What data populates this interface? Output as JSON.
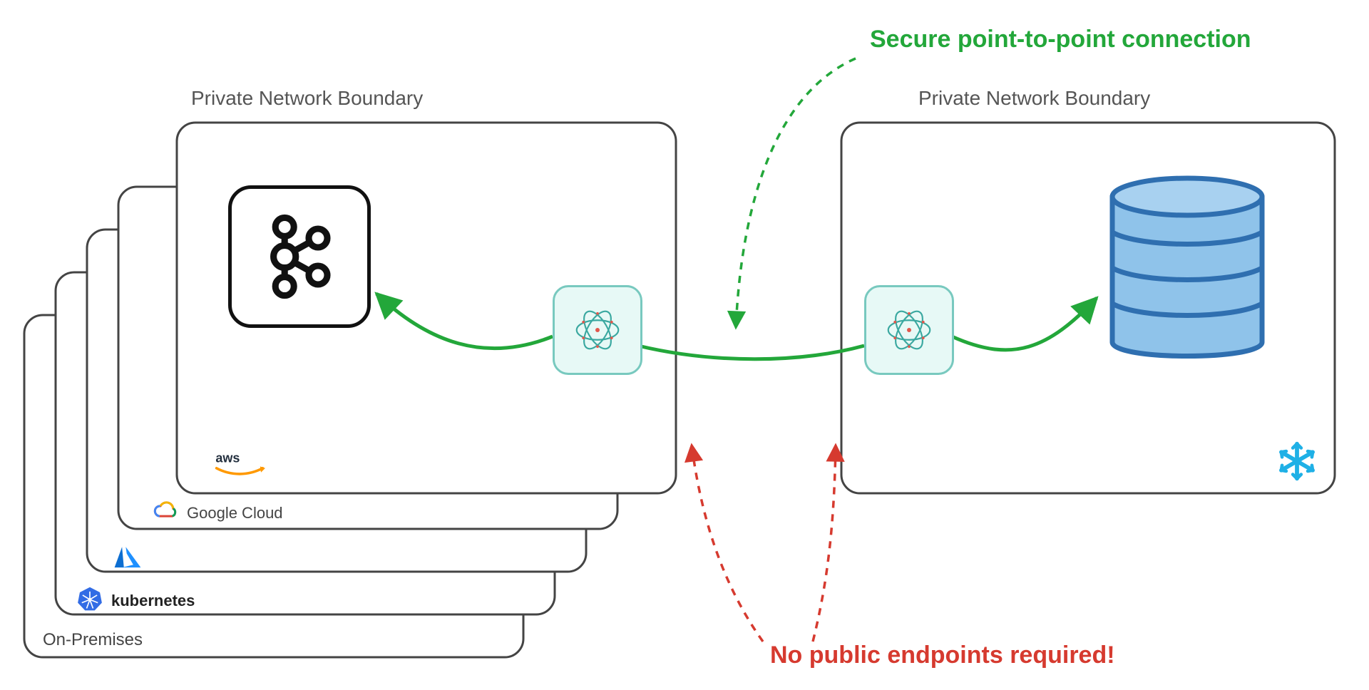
{
  "left_boundary_title": "Private Network Boundary",
  "right_boundary_title": "Private Network Boundary",
  "annotation_green": "Secure point-to-point connection",
  "annotation_red": "No public endpoints required!",
  "stack_labels": {
    "aws": "aws",
    "gcp": "Google Cloud",
    "azure": "",
    "kubernetes": "kubernetes",
    "on_prem": "On-Premises"
  },
  "icons": {
    "kafka": "kafka-icon",
    "ockam_left": "ockam-node-icon",
    "ockam_right": "ockam-node-icon",
    "database": "database-icon",
    "snowflake": "snowflake-icon",
    "aws": "aws-logo-icon",
    "gcp": "google-cloud-logo-icon",
    "azure": "azure-logo-icon",
    "kubernetes": "kubernetes-logo-icon"
  },
  "colors": {
    "boundary_stroke": "#444444",
    "green": "#23a73a",
    "red": "#d63a2f",
    "db_fill": "#8fc3ea",
    "db_stroke": "#2f6fb0",
    "ockam_fill": "#e7f9f6",
    "ockam_stroke": "#78c9bf",
    "snowflake": "#1fb0e6"
  },
  "diagram_semantics": {
    "left": {
      "contains": [
        "kafka",
        "ockam-node"
      ],
      "runs_on_options": [
        "aws",
        "google-cloud",
        "azure",
        "kubernetes",
        "on-premises"
      ]
    },
    "right": {
      "contains": [
        "ockam-node",
        "database"
      ],
      "provider": "snowflake"
    },
    "green_link": {
      "from": "ockam-node-left",
      "to": "ockam-node-right",
      "also_to": [
        "kafka",
        "database"
      ],
      "label": "Secure point-to-point connection"
    },
    "red_note": {
      "points_at": [
        "left-boundary",
        "right-boundary"
      ],
      "label": "No public endpoints required!"
    }
  }
}
